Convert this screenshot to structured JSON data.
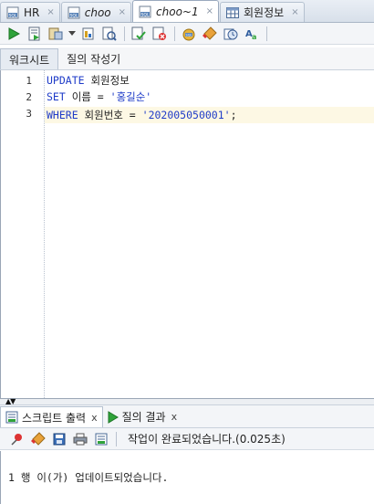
{
  "tabs": [
    {
      "label": "HR",
      "icon": "sql-file-icon",
      "italic": false,
      "active": false
    },
    {
      "label": "choo",
      "icon": "sql-file-icon",
      "italic": true,
      "active": false
    },
    {
      "label": "choo~1",
      "icon": "sql-file-icon",
      "italic": true,
      "active": true
    },
    {
      "label": "회원정보",
      "icon": "table-icon",
      "italic": false,
      "active": false
    }
  ],
  "tab_close_glyph": "×",
  "toolbar_icons": [
    "run-statement-icon",
    "run-script-icon",
    "explain-plan-icon",
    "autotrace-icon",
    "sql-tuning-icon",
    "commit-icon",
    "rollback-icon",
    "unshared-sql-icon",
    "clear-eraser-icon",
    "history-icon",
    "format-icon"
  ],
  "worksheet_tabs": {
    "worksheet": "워크시트",
    "query_builder": "질의 작성기"
  },
  "editor": {
    "lines": [
      {
        "num": "1",
        "parts": [
          {
            "t": "UPDATE",
            "k": "kw"
          },
          {
            "t": " 회원정보",
            "k": ""
          }
        ]
      },
      {
        "num": "2",
        "parts": [
          {
            "t": "SET",
            "k": "kw"
          },
          {
            "t": " 이름 = ",
            "k": ""
          },
          {
            "t": "'홍길순'",
            "k": "str"
          }
        ]
      },
      {
        "num": "3",
        "parts": [
          {
            "t": "WHERE",
            "k": "kw"
          },
          {
            "t": " 회원번호 = ",
            "k": ""
          },
          {
            "t": "'202005050001'",
            "k": "str"
          },
          {
            "t": ";",
            "k": ""
          }
        ]
      }
    ]
  },
  "output_tabs": {
    "script_output": "스크립트 출력",
    "query_result": "질의 결과",
    "close_glyph": "x"
  },
  "output_toolbar": {
    "status": "작업이 완료되었습니다.(0.025초)"
  },
  "output_text": "1 행 이(가) 업데이트되었습니다.",
  "colors": {
    "keyword": "#1f3cc8",
    "current_line": "#fdf8e4",
    "tab_active": "#ffffff"
  }
}
